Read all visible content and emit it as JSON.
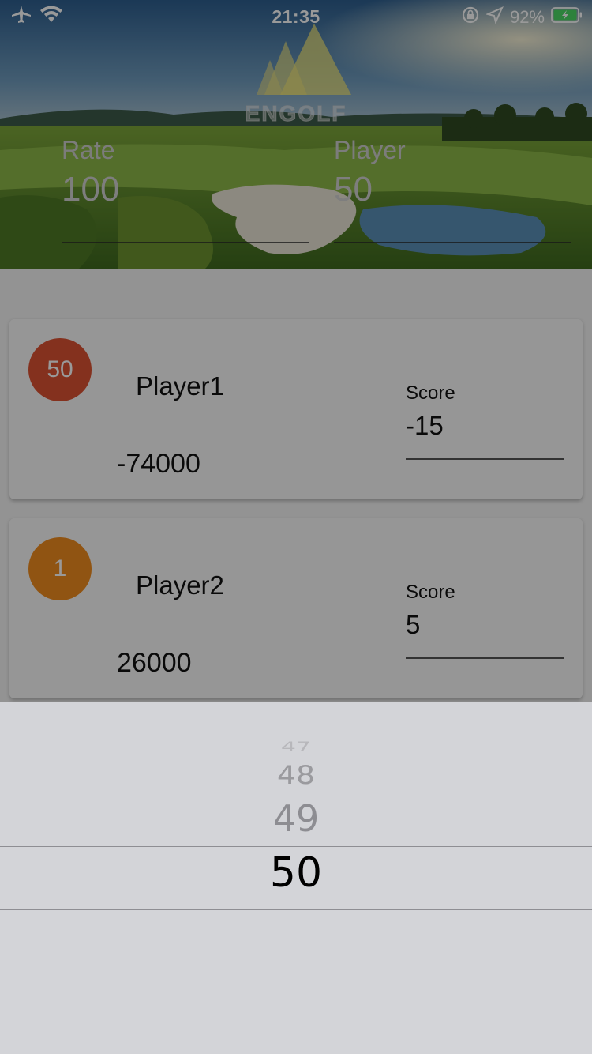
{
  "status_bar": {
    "time": "21:35",
    "battery": "92%",
    "left_icons": [
      "airplane-icon",
      "wifi-icon"
    ],
    "right_icons": [
      "rotation-lock-icon",
      "location-arrow-icon",
      "battery-icon"
    ]
  },
  "header": {
    "logo_text": "ENGOLF",
    "rate_label": "Rate",
    "rate_value": "100",
    "player_label": "Player",
    "player_value": "50"
  },
  "cards": [
    {
      "badge": "50",
      "badge_color": "#dd5232",
      "name": "Player1",
      "amount": "-74000",
      "score_label": "Score",
      "score": "-15"
    },
    {
      "badge": "1",
      "badge_color": "#f08c1e",
      "name": "Player2",
      "amount": "26000",
      "score_label": "Score",
      "score": "5"
    }
  ],
  "picker": {
    "items": [
      "47",
      "48",
      "49",
      "50"
    ],
    "selected": "50"
  }
}
